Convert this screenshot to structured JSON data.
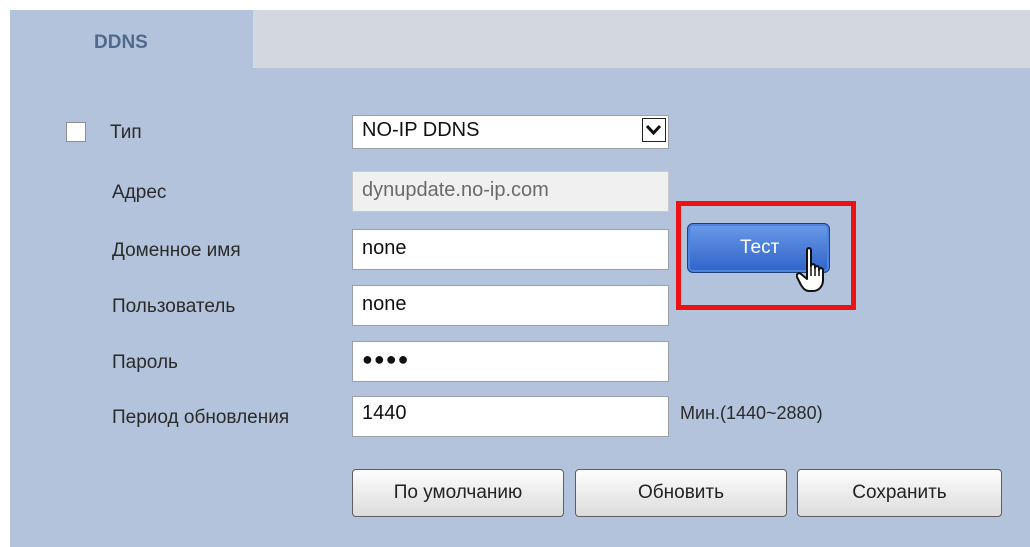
{
  "tab": {
    "label": "DDNS"
  },
  "form": {
    "type": {
      "label": "Тип",
      "value": "NO-IP DDNS",
      "checked": false
    },
    "address": {
      "label": "Адрес",
      "value": "dynupdate.no-ip.com"
    },
    "domain": {
      "label": "Доменное имя",
      "value": "none"
    },
    "user": {
      "label": "Пользователь",
      "value": "none"
    },
    "password": {
      "label": "Пароль",
      "value": "●●●●"
    },
    "period": {
      "label": "Период обновления",
      "value": "1440",
      "units": "Мин.(1440~2880)"
    }
  },
  "buttons": {
    "test": "Тест",
    "default": "По умолчанию",
    "refresh": "Обновить",
    "save": "Сохранить"
  },
  "colors": {
    "highlight": "#ee1111",
    "test_button": "#3b6fd0",
    "panel": "#b3c3db"
  },
  "icons": [
    "hand-pointer-icon",
    "chevron-down-icon"
  ]
}
